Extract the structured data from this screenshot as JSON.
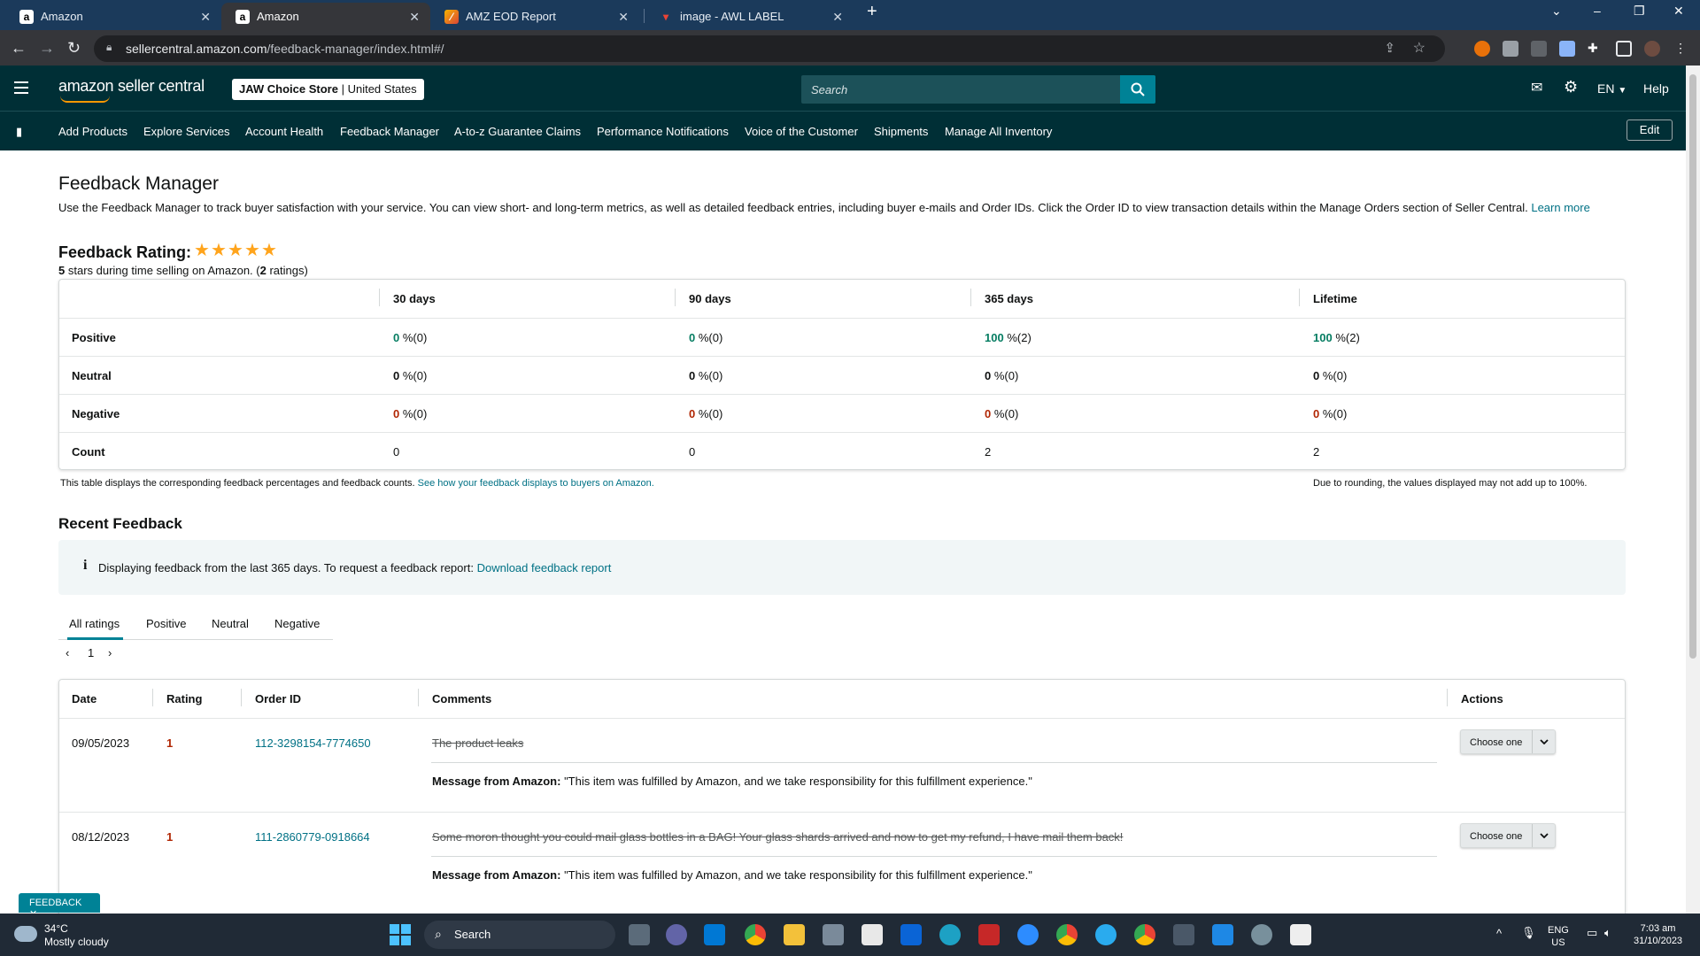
{
  "browser": {
    "tabs": [
      {
        "title": "Amazon",
        "icon": "amazon-icon"
      },
      {
        "title": "Amazon",
        "icon": "amazon-icon"
      },
      {
        "title": "AMZ EOD Report",
        "icon": "sheets-icon"
      },
      {
        "title": "image - AWL LABEL",
        "icon": "gmail-icon"
      }
    ],
    "new_tab": "+",
    "url_host": "sellercentral.amazon.com",
    "url_path": "/feedback-manager/index.html#/"
  },
  "header": {
    "logo": "amazon seller central",
    "store_name": "JAW Choice Store",
    "store_region": "United States",
    "search_placeholder": "Search",
    "lang": "EN",
    "help": "Help"
  },
  "nav": {
    "items": [
      "Add Products",
      "Explore Services",
      "Account Health",
      "Feedback Manager",
      "A-to-z Guarantee Claims",
      "Performance Notifications",
      "Voice of the Customer",
      "Shipments",
      "Manage All Inventory"
    ],
    "edit": "Edit"
  },
  "page": {
    "title": "Feedback Manager",
    "description": "Use the Feedback Manager to track buyer satisfaction with your service. You can view short- and long-term metrics, as well as detailed feedback entries, including buyer e-mails and Order IDs. Click the Order ID to view transaction details within the Manage Orders section of Seller Central.",
    "learn_more": "Learn more",
    "rating_title": "Feedback Rating:",
    "rating_stars": 5,
    "rating_value": "5",
    "rating_text_mid": " stars during time selling on Amazon. (",
    "rating_count": "2",
    "rating_text_end": " ratings)"
  },
  "metrics": {
    "columns": [
      "30 days",
      "90 days",
      "365 days",
      "Lifetime"
    ],
    "rows": [
      {
        "label": "Positive",
        "cells": [
          {
            "v": "0",
            "r": "%(0)"
          },
          {
            "v": "0",
            "r": "%(0)"
          },
          {
            "v": "100",
            "r": "%(2)"
          },
          {
            "v": "100",
            "r": "%(2)"
          }
        ]
      },
      {
        "label": "Neutral",
        "cells": [
          {
            "v": "0",
            "r": "%(0)"
          },
          {
            "v": "0",
            "r": "%(0)"
          },
          {
            "v": "0",
            "r": "%(0)"
          },
          {
            "v": "0",
            "r": "%(0)"
          }
        ]
      },
      {
        "label": "Negative",
        "cells": [
          {
            "v": "0",
            "r": "%(0)"
          },
          {
            "v": "0",
            "r": "%(0)"
          },
          {
            "v": "0",
            "r": "%(0)"
          },
          {
            "v": "0",
            "r": "%(0)"
          }
        ]
      },
      {
        "label": "Count",
        "cells": [
          {
            "v": "0"
          },
          {
            "v": "0"
          },
          {
            "v": "2"
          },
          {
            "v": "2"
          }
        ]
      }
    ],
    "note_left": "This table displays the corresponding feedback percentages and feedback counts.",
    "note_link": "See how your feedback displays to buyers on Amazon.",
    "note_right": "Due to rounding, the values displayed may not add up to 100%."
  },
  "recent": {
    "title": "Recent Feedback",
    "info_icon": "i",
    "info_text": "Displaying feedback from the last 365 days. To request a feedback report:",
    "info_link": "Download feedback report",
    "tabs": [
      "All ratings",
      "Positive",
      "Neutral",
      "Negative"
    ],
    "page": "1",
    "columns": [
      "Date",
      "Rating",
      "Order ID",
      "Comments",
      "Actions"
    ],
    "rows": [
      {
        "date": "09/05/2023",
        "rating": "1",
        "order": "112-3298154-7774650",
        "comment": "The product leaks",
        "msg_label": "Message from Amazon:",
        "msg": "\"This item was fulfilled by Amazon, and we take responsibility for this fulfillment experience.\"",
        "action": "Choose one"
      },
      {
        "date": "08/12/2023",
        "rating": "1",
        "order": "111-2860779-0918664",
        "comment": "Some moron thought you could mail glass bottles in a BAG! Your glass shards arrived and now to get my refund, I have mail them back!",
        "msg_label": "Message from Amazon:",
        "msg": "\"This item was fulfilled by Amazon, and we take responsibility for this fulfillment experience.\"",
        "action": "Choose one"
      }
    ]
  },
  "feedback_badge": "FEEDBACK",
  "taskbar": {
    "temp": "34°C",
    "weather": "Mostly cloudy",
    "search": "Search",
    "lang1": "ENG",
    "lang2": "US",
    "time": "7:03 am",
    "date": "31/10/2023"
  }
}
